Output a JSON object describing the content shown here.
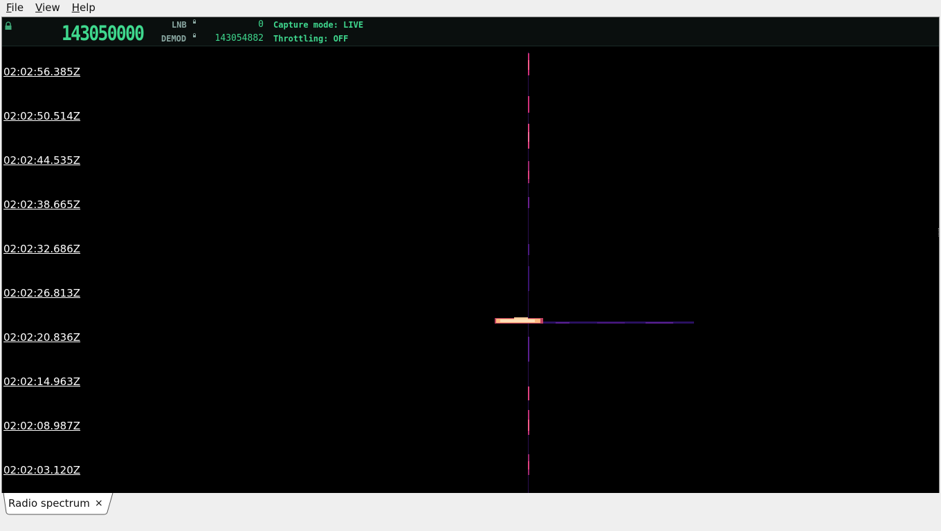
{
  "menu": [
    {
      "label": "File",
      "mnemonic": "F",
      "rest": "ile"
    },
    {
      "label": "View",
      "mnemonic": "V",
      "rest": "iew"
    },
    {
      "label": "Help",
      "mnemonic": "H",
      "rest": "elp"
    }
  ],
  "header": {
    "main_frequency": "143050000",
    "lnb_label": "LNB",
    "lnb_value": "0",
    "demod_label": "DEMOD",
    "demod_value": "143054882",
    "capture_mode": "Capture mode: LIVE",
    "throttling": "Throttling: OFF"
  },
  "waterfall": {
    "timestamps": [
      "02:02:56.385Z",
      "02:02:50.514Z",
      "02:02:44.535Z",
      "02:02:38.665Z",
      "02:02:32.686Z",
      "02:02:26.813Z",
      "02:02:20.836Z",
      "02:02:14.963Z",
      "02:02:08.987Z",
      "02:02:03.120Z"
    ]
  },
  "tabs": [
    {
      "label": "Radio spectrum",
      "close_glyph": "×"
    }
  ],
  "colors": {
    "accent_green": "#3fd88e",
    "signal_magenta": "#e0307a",
    "signal_hot": "#ffd8a0",
    "signal_purple": "#5a2090"
  },
  "icons": {
    "lock": "lock-icon",
    "close": "close-icon"
  }
}
